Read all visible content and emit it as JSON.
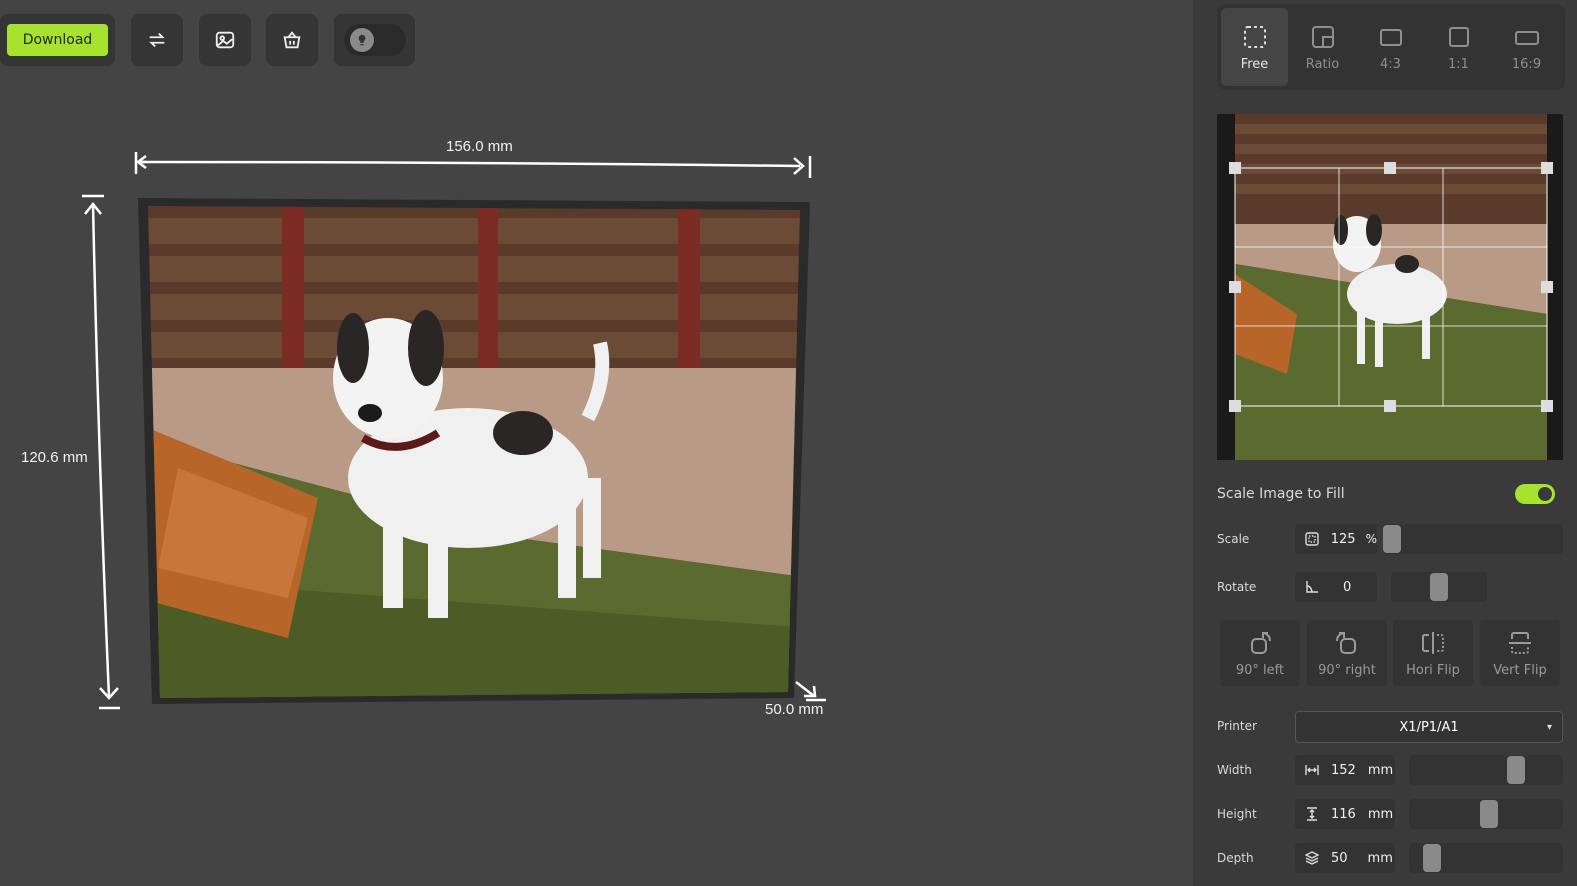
{
  "toolbar": {
    "download_label": "Download",
    "icons": [
      "swap-icon",
      "image-icon",
      "basket-icon",
      "lightbulb-icon"
    ]
  },
  "canvas": {
    "width_label": "156.0 mm",
    "height_label": "120.6 mm",
    "depth_label": "50.0 mm"
  },
  "crop_tabs": [
    {
      "label": "Free",
      "icon": "free-crop-icon",
      "active": true
    },
    {
      "label": "Ratio",
      "icon": "ratio-icon",
      "active": false
    },
    {
      "label": "4:3",
      "icon": "ratio-4-3-icon",
      "active": false
    },
    {
      "label": "1:1",
      "icon": "ratio-1-1-icon",
      "active": false
    },
    {
      "label": "16:9",
      "icon": "ratio-16-9-icon",
      "active": false
    }
  ],
  "scale_to_fill": {
    "label": "Scale Image to Fill",
    "on": true
  },
  "scale": {
    "label": "Scale",
    "value": "125",
    "unit": "%",
    "level": 0.0
  },
  "rotate": {
    "label": "Rotate",
    "value": "0",
    "level": 0.5
  },
  "actions": [
    {
      "label": "90° left",
      "icon": "rotate-left-icon"
    },
    {
      "label": "90° right",
      "icon": "rotate-right-icon"
    },
    {
      "label": "Hori Flip",
      "icon": "flip-horizontal-icon"
    },
    {
      "label": "Vert Flip",
      "icon": "flip-vertical-icon"
    }
  ],
  "printer": {
    "label": "Printer",
    "value": "X1/P1/A1"
  },
  "width": {
    "label": "Width",
    "value": "152",
    "unit": "mm",
    "level": 0.72
  },
  "height": {
    "label": "Height",
    "value": "116",
    "unit": "mm",
    "level": 0.52
  },
  "depth": {
    "label": "Depth",
    "value": "50",
    "unit": "mm",
    "level": 0.1
  },
  "accent_color": "#a6e22e"
}
